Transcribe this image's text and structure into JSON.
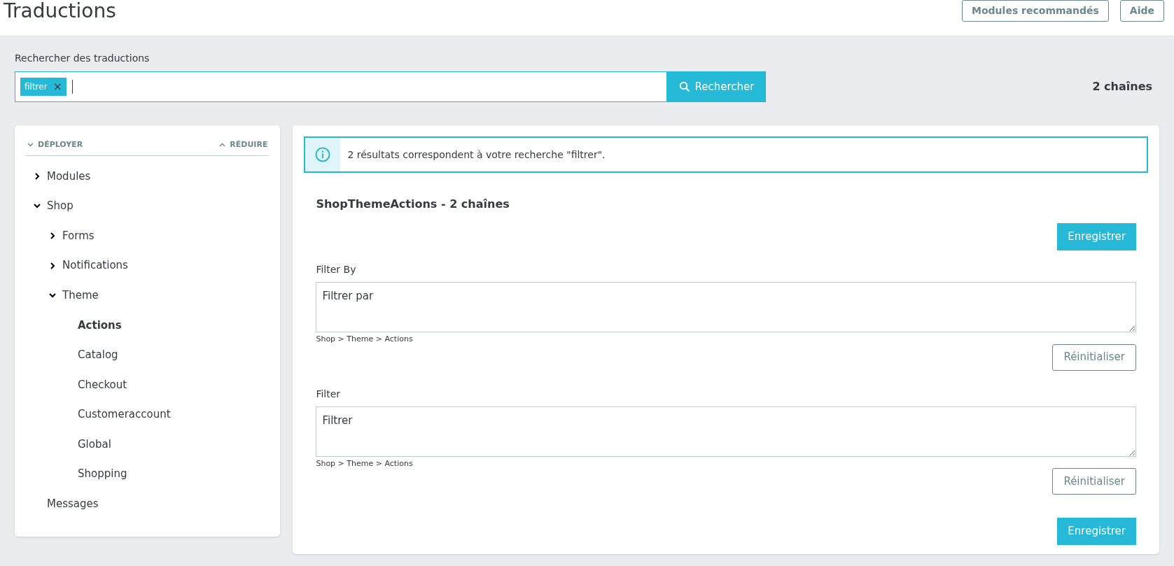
{
  "header": {
    "title": "Traductions",
    "buttons": [
      "Modules recommandés",
      "Aide"
    ]
  },
  "search": {
    "label": "Rechercher des traductions",
    "tags": [
      "filtrer"
    ],
    "tag_remove": "×",
    "button": "Rechercher",
    "count": "2 chaînes"
  },
  "sidebar": {
    "expand": "DÉPLOYER",
    "collapse": "RÉDUIRE",
    "items": [
      {
        "kind": "folder",
        "label": "Modules",
        "expanded": false,
        "selected": false
      },
      {
        "kind": "folder",
        "label": "Shop",
        "expanded": true,
        "selected": false,
        "children": [
          {
            "kind": "folder",
            "label": "Forms",
            "expanded": false,
            "selected": false
          },
          {
            "kind": "folder",
            "label": "Notifications",
            "expanded": false,
            "selected": false
          },
          {
            "kind": "folder",
            "label": "Theme",
            "expanded": true,
            "selected": false,
            "children": [
              {
                "kind": "leaf",
                "label": "Actions",
                "selected": true
              },
              {
                "kind": "leaf",
                "label": "Catalog",
                "selected": false
              },
              {
                "kind": "leaf",
                "label": "Checkout",
                "selected": false
              },
              {
                "kind": "leaf",
                "label": "Customeraccount",
                "selected": false
              },
              {
                "kind": "leaf",
                "label": "Global",
                "selected": false
              },
              {
                "kind": "leaf",
                "label": "Shopping",
                "selected": false
              }
            ]
          }
        ]
      },
      {
        "kind": "leaf",
        "label": "Messages",
        "selected": false
      }
    ]
  },
  "main": {
    "info": "2 résultats correspondent à votre recherche \"filtrer\".",
    "section_title": "ShopThemeActions - 2 chaînes",
    "save_button": "Enregistrer",
    "entries": [
      {
        "source": "Filter By",
        "translation": "Filtrer par",
        "path": "Shop > Theme > Actions",
        "reset_button": "Réinitialiser"
      },
      {
        "source": "Filter",
        "translation": "Filtrer",
        "path": "Shop > Theme > Actions",
        "reset_button": "Réinitialiser"
      }
    ],
    "save_button_bottom": "Enregistrer"
  }
}
